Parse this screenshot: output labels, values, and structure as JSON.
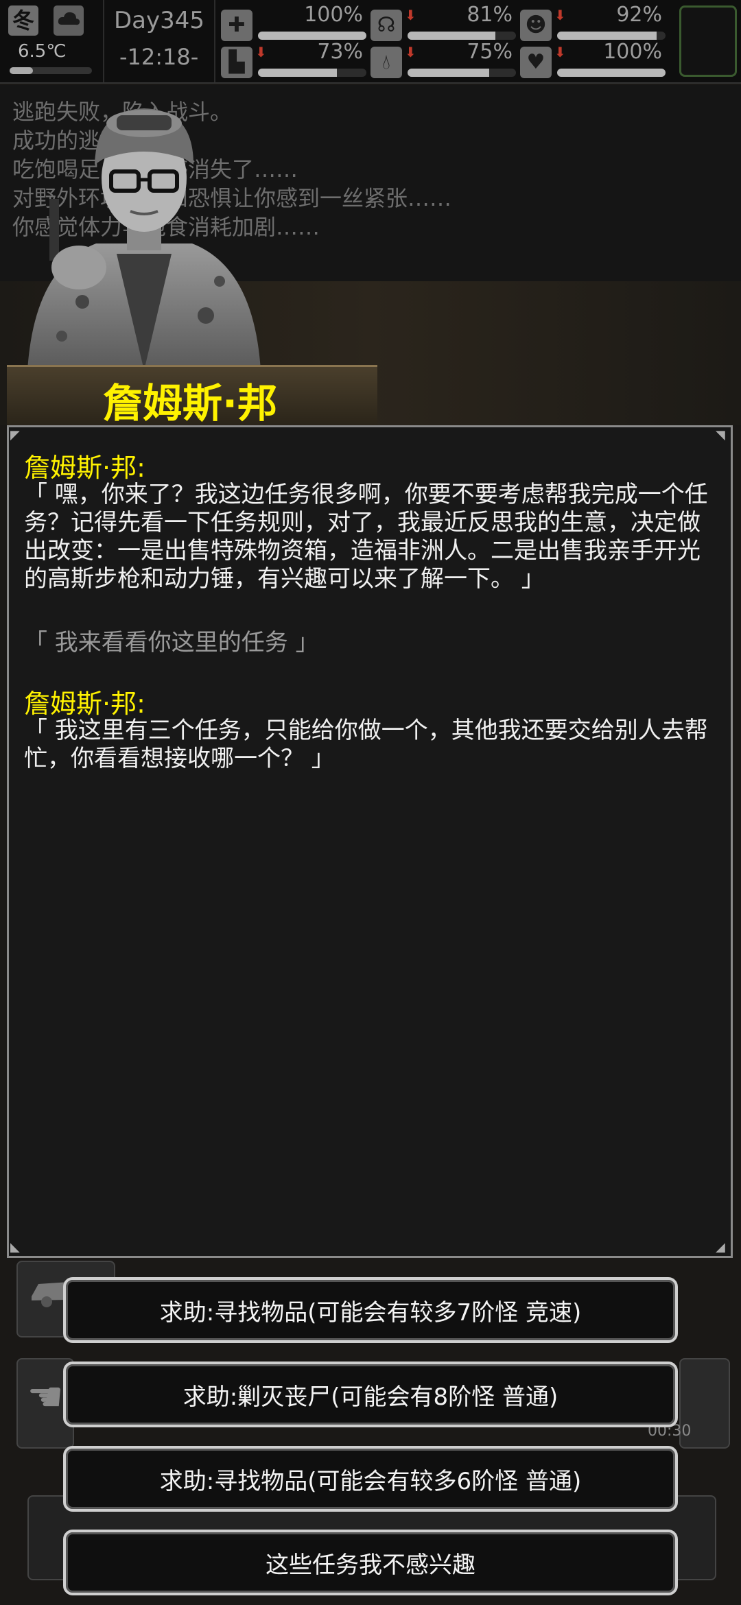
{
  "status": {
    "season": "冬",
    "weather_icon": "cloud-icon",
    "temperature": "6.5℃",
    "day": "Day345",
    "time": "-12:18-",
    "stats": [
      {
        "icon": "medkit-icon",
        "value": "100%",
        "level": 1.0
      },
      {
        "icon": "stomach-icon",
        "value": "81%",
        "level": 0.81
      },
      {
        "icon": "mood-icon",
        "value": "92%",
        "level": 0.92
      },
      {
        "icon": "boot-icon",
        "value": "73%",
        "level": 0.73
      },
      {
        "icon": "water-drop-icon",
        "value": "75%",
        "level": 0.75
      },
      {
        "icon": "heart-icon",
        "value": "100%",
        "level": 1.0
      }
    ]
  },
  "log": [
    "逃跑失败，陷入战斗。",
    "成功的逃离战斗。",
    "吃饱喝足，饥渴感消失了……",
    "对野外环境的未知恐惧让你感到一丝紧张……",
    "你感觉体力与饱食消耗加剧……"
  ],
  "npc": {
    "name": "詹姆斯·邦"
  },
  "dialog": {
    "speaker1": "詹姆斯·邦:",
    "text1": "「 嘿，你来了？我这边任务很多啊，你要不要考虑帮我完成一个任务？记得先看一下任务规则，对了，我最近反思我的生意，决定做出改变：一是出售特殊物资箱，造福非洲人。二是出售我亲手开光的高斯步枪和动力锤，有兴趣可以来了解一下。 」",
    "player_reply": "「 我来看看你这里的任务 」",
    "speaker2": "詹姆斯·邦:",
    "text2": "「 我这里有三个任务，只能给你做一个，其他我还要交给别人去帮忙，你看看想接收哪一个？ 」"
  },
  "choices": [
    "求助:寻找物品(可能会有较多7阶怪  竞速)",
    "求助:剿灭丧尸(可能会有8阶怪  普通)",
    "求助:寻找物品(可能会有较多6阶怪  普通)",
    "这些任务我不感兴趣"
  ],
  "background": {
    "timer": "00:30"
  }
}
